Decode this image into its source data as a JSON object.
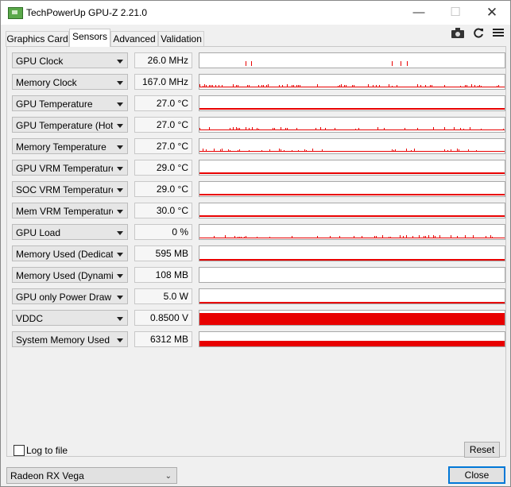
{
  "window": {
    "title": "TechPowerUp GPU-Z 2.21.0"
  },
  "window_controls": {
    "minimize": "—",
    "maximize": "☐",
    "close": "✕"
  },
  "tabs": [
    {
      "label": "Graphics Card"
    },
    {
      "label": "Sensors"
    },
    {
      "label": "Advanced"
    },
    {
      "label": "Validation"
    }
  ],
  "toolbar": {
    "camera_icon": "camera-icon",
    "refresh_icon": "refresh-icon",
    "menu_icon": "hamburger-menu-icon"
  },
  "graph_color": "#e80000",
  "sensors": [
    {
      "label": "GPU Clock",
      "value": "26.0 MHz",
      "graph": {
        "style": "spikes",
        "spikes": [
          0.15,
          0.17,
          0.63,
          0.66,
          0.68
        ],
        "height": 0.35
      }
    },
    {
      "label": "Memory Clock",
      "value": "167.0 MHz",
      "graph": {
        "style": "noise",
        "level": 0.12,
        "density": 0.9
      }
    },
    {
      "label": "GPU Temperature",
      "value": "27.0 °C",
      "graph": {
        "style": "flat",
        "level": 0.1
      }
    },
    {
      "label": "GPU Temperature (Hot Spot)",
      "value": "27.0 °C",
      "graph": {
        "style": "noise",
        "level": 0.1,
        "density": 0.5
      }
    },
    {
      "label": "Memory Temperature",
      "value": "27.0 °C",
      "graph": {
        "style": "noise",
        "level": 0.1,
        "density": 0.4
      }
    },
    {
      "label": "GPU VRM Temperature",
      "value": "29.0 °C",
      "graph": {
        "style": "flat",
        "level": 0.12
      }
    },
    {
      "label": "SOC VRM Temperature",
      "value": "29.0 °C",
      "graph": {
        "style": "flat",
        "level": 0.12
      }
    },
    {
      "label": "Mem VRM Temperature",
      "value": "30.0 °C",
      "graph": {
        "style": "flat",
        "level": 0.12
      }
    },
    {
      "label": "GPU Load",
      "value": "0 %",
      "graph": {
        "style": "noise",
        "level": 0.05,
        "density": 0.5
      }
    },
    {
      "label": "Memory Used (Dedicated)",
      "value": "595 MB",
      "graph": {
        "style": "flat",
        "level": 0.08
      }
    },
    {
      "label": "Memory Used (Dynamic)",
      "value": "108 MB",
      "graph": {
        "style": "flat",
        "level": 0.0
      }
    },
    {
      "label": "GPU only Power Draw",
      "value": "5.0 W",
      "graph": {
        "style": "flat",
        "level": 0.03
      }
    },
    {
      "label": "VDDC",
      "value": "0.8500 V",
      "graph": {
        "style": "fill",
        "level": 0.85
      }
    },
    {
      "label": "System Memory Used",
      "value": "6312 MB",
      "graph": {
        "style": "fill",
        "level": 0.4
      }
    }
  ],
  "log_to_file": {
    "label": "Log to file",
    "checked": false
  },
  "reset_button": {
    "label": "Reset"
  },
  "gpu_select": {
    "value": "Radeon RX Vega"
  },
  "close_button": {
    "label": "Close"
  }
}
